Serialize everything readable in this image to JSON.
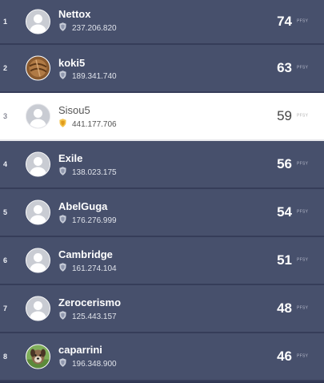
{
  "leaderboard": {
    "unit_label": "PFSY",
    "rows": [
      {
        "rank": "1",
        "name": "Nettox",
        "value": "237.206.820",
        "score": "74",
        "avatar": "default-avatar-icon",
        "shield": "silver",
        "highlighted": false
      },
      {
        "rank": "2",
        "name": "koki5",
        "value": "189.341.740",
        "score": "63",
        "avatar": "brown-photo-avatar",
        "shield": "silver",
        "highlighted": false
      },
      {
        "rank": "3",
        "name": "Sisou5",
        "value": "441.177.706",
        "score": "59",
        "avatar": "default-avatar-icon",
        "shield": "gold",
        "highlighted": true
      },
      {
        "rank": "4",
        "name": "Exile",
        "value": "138.023.175",
        "score": "56",
        "avatar": "default-avatar-icon",
        "shield": "silver",
        "highlighted": false
      },
      {
        "rank": "5",
        "name": "AbelGuga",
        "value": "176.276.999",
        "score": "54",
        "avatar": "default-avatar-icon",
        "shield": "silver",
        "highlighted": false
      },
      {
        "rank": "6",
        "name": "Cambridge",
        "value": "161.274.104",
        "score": "51",
        "avatar": "default-avatar-icon",
        "shield": "silver",
        "highlighted": false
      },
      {
        "rank": "7",
        "name": "Zerocerismo",
        "value": "125.443.157",
        "score": "48",
        "avatar": "default-avatar-icon",
        "shield": "silver",
        "highlighted": false
      },
      {
        "rank": "8",
        "name": "caparrini",
        "value": "196.348.900",
        "score": "46",
        "avatar": "dog-photo-avatar",
        "shield": "silver",
        "highlighted": false
      }
    ]
  },
  "colors": {
    "row_bg": "#47506c",
    "highlight_bg": "#ffffff",
    "shield_silver": "#c7ccd8",
    "shield_gold": "#f3c24a"
  }
}
